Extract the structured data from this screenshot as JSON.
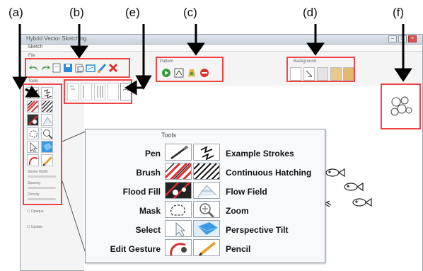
{
  "callouts": {
    "a": "(a)",
    "b": "(b)",
    "c": "(c)",
    "d": "(d)",
    "e": "(e)",
    "f": "(f)"
  },
  "window": {
    "title": "Hybrid Vector Sketching",
    "menu": "Sketch"
  },
  "toolbar_groups": {
    "file": "File",
    "pattern": "Pattern",
    "background": "Background",
    "tools": "Tools"
  },
  "left_panel": {
    "sliders": [
      "Stroke Width",
      "Spacing",
      "Density"
    ],
    "checkboxes": [
      "Opaque",
      "Update"
    ]
  },
  "tools_panel": {
    "title": "Tools",
    "left_labels": [
      "Pen",
      "Brush",
      "Flood Fill",
      "Mask",
      "Select",
      "Edit Gesture"
    ],
    "right_labels": [
      "Example Strokes",
      "Continuous Hatching",
      "Flow Field",
      "Zoom",
      "Perspective Tilt",
      "Pencil"
    ]
  },
  "colors": {
    "highlight": "#f04545",
    "accent_green": "#3a9a3a",
    "accent_red": "#d93030",
    "accent_blue": "#2a8ad8"
  },
  "icons": [
    "undo-icon",
    "redo-icon",
    "new-icon",
    "save-icon",
    "open-icon",
    "export-icon",
    "brush-icon",
    "delete-icon",
    "play-icon",
    "pattern-icon",
    "fill-icon",
    "stop-icon",
    "pen-icon",
    "example-strokes-icon",
    "hatching-icon",
    "flood-fill-icon",
    "mask-icon",
    "zoom-icon",
    "select-icon",
    "tilt-icon",
    "edit-gesture-icon",
    "pencil-icon",
    "fish-icon"
  ]
}
